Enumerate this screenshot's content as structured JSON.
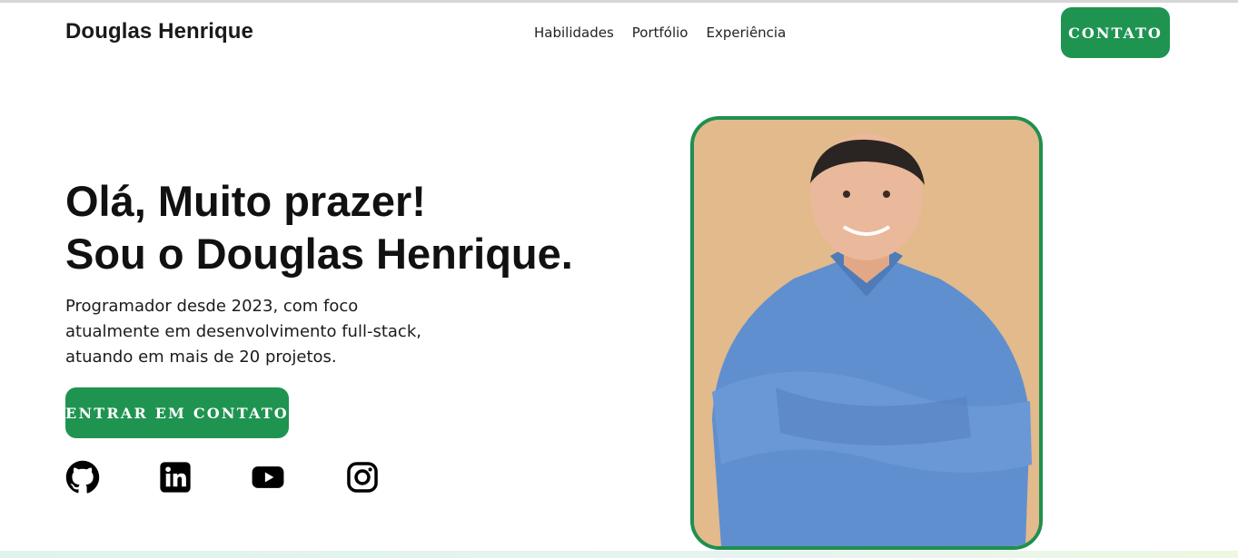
{
  "header": {
    "brand": "Douglas Henrique",
    "nav": [
      "Habilidades",
      "Portfólio",
      "Experiência"
    ],
    "contact_button": "CONTATO"
  },
  "hero": {
    "title_line1": "Olá, Muito prazer!",
    "title_line2": "Sou o Douglas Henrique.",
    "description": "Programador desde 2023, com foco atualmente em desenvolvimento full-stack, atuando em mais de 20 projetos.",
    "cta_button": "ENTRAR EM CONTATO"
  },
  "socials": [
    {
      "icon": "github-icon"
    },
    {
      "icon": "linkedin-icon"
    },
    {
      "icon": "youtube-icon"
    },
    {
      "icon": "instagram-icon"
    }
  ],
  "colors": {
    "accent": "#1f9451",
    "frame_border": "#1f8f4f",
    "text": "#111111"
  }
}
